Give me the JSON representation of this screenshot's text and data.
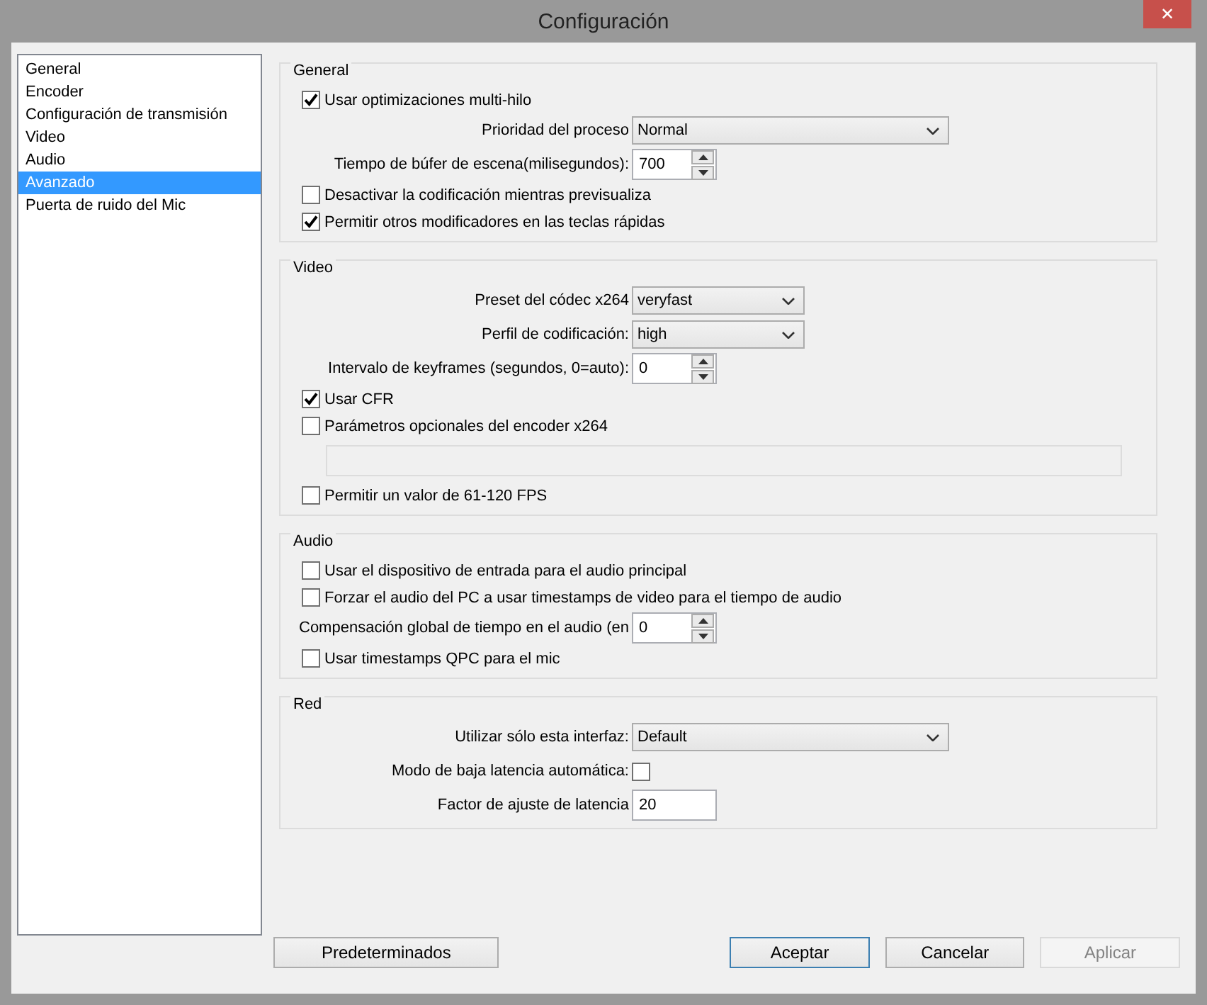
{
  "window": {
    "title": "Configuración",
    "close": "✕"
  },
  "sidebar": {
    "items": [
      {
        "label": "General",
        "selected": false
      },
      {
        "label": "Encoder",
        "selected": false
      },
      {
        "label": "Configuración de transmisión",
        "selected": false
      },
      {
        "label": "Video",
        "selected": false
      },
      {
        "label": "Audio",
        "selected": false
      },
      {
        "label": "Avanzado",
        "selected": true
      },
      {
        "label": "Puerta de ruido del Mic",
        "selected": false
      }
    ]
  },
  "sections": [
    {
      "title": "General",
      "rows": [
        {
          "kind": "check",
          "label": "Usar optimizaciones multi-hilo",
          "checked": true
        },
        {
          "kind": "select",
          "label": "Prioridad del proceso",
          "value": "Normal"
        },
        {
          "kind": "spin",
          "label": "Tiempo de búfer de escena(milisegundos):",
          "value": "700"
        },
        {
          "kind": "check",
          "label": "Desactivar la codificación mientras previsualiza",
          "checked": false
        },
        {
          "kind": "check",
          "label": "Permitir otros modificadores en las teclas rápidas",
          "checked": true
        }
      ]
    },
    {
      "title": "Video",
      "rows": [
        {
          "kind": "select",
          "label": "Preset del códec x264",
          "value": "veryfast"
        },
        {
          "kind": "select",
          "label": "Perfil de codificación:",
          "value": "high"
        },
        {
          "kind": "spin",
          "label": "Intervalo de keyframes (segundos, 0=auto):",
          "value": "0"
        },
        {
          "kind": "check",
          "label": "Usar CFR",
          "checked": true
        },
        {
          "kind": "check",
          "label": "Parámetros opcionales del encoder x264",
          "checked": false
        },
        {
          "kind": "field"
        },
        {
          "kind": "check",
          "label": "Permitir un valor de 61-120 FPS",
          "checked": false
        }
      ]
    },
    {
      "title": "Audio",
      "rows": [
        {
          "kind": "check",
          "label": "Usar el dispositivo de entrada para el audio principal",
          "checked": false
        },
        {
          "kind": "check",
          "label": "Forzar el audio del PC a usar timestamps de video para el tiempo de audio",
          "checked": false
        },
        {
          "kind": "spin",
          "label": "Compensación global de tiempo en el audio (en",
          "value": "0"
        },
        {
          "kind": "check",
          "label": "Usar timestamps QPC para el mic",
          "checked": false
        }
      ]
    },
    {
      "title": "Red",
      "rows": [
        {
          "kind": "select",
          "label": "Utilizar sólo esta interfaz:",
          "value": "Default"
        },
        {
          "kind": "check_right",
          "label": "Modo de baja latencia automática:",
          "checked": false
        },
        {
          "kind": "text",
          "label": "Factor de ajuste de latencia",
          "value": "20"
        }
      ]
    }
  ],
  "buttons": [
    {
      "label": "Predeterminados",
      "kind": "normal"
    },
    {
      "label": "Aceptar",
      "kind": "default"
    },
    {
      "label": "Cancelar",
      "kind": "normal"
    },
    {
      "label": "Aplicar",
      "kind": "disabled"
    }
  ]
}
